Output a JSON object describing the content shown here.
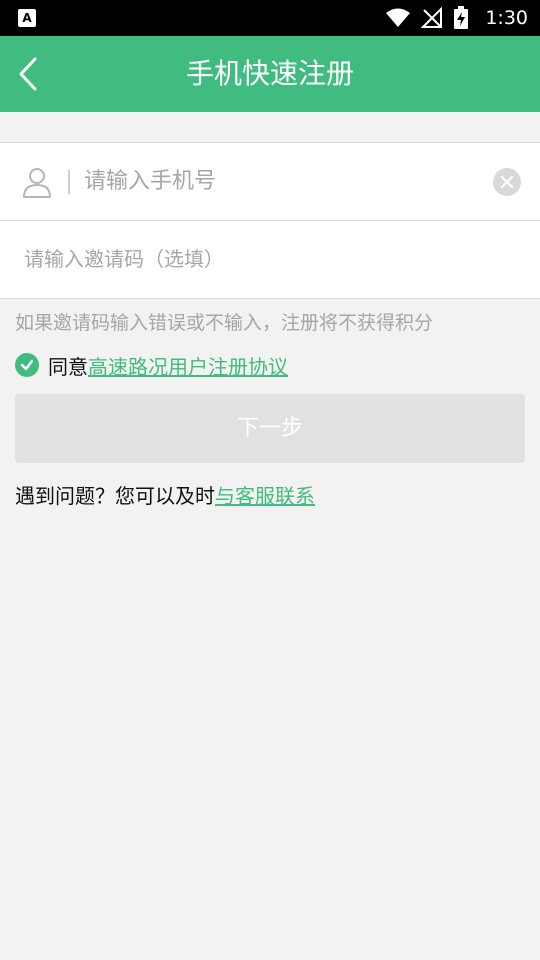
{
  "status_bar": {
    "left_icon": "A",
    "time": "1:30",
    "icons": [
      "wifi-icon",
      "no-signal-icon",
      "battery-charging-icon"
    ]
  },
  "header": {
    "title": "手机快速注册",
    "back_icon": "chevron-left-icon",
    "background_color": "#41bc80"
  },
  "form": {
    "phone": {
      "placeholder": "请输入手机号",
      "value": "",
      "icon": "user-icon",
      "clear_icon": "clear-icon"
    },
    "invite": {
      "placeholder": "请输入邀请码（选填）",
      "value": ""
    }
  },
  "hint": "如果邀请码输入错误或不输入，注册将不获得积分",
  "agreement": {
    "checked": true,
    "prefix": "同意",
    "link_text": "高速路况用户注册协议"
  },
  "next_button": {
    "label": "下一步"
  },
  "help": {
    "prefix": "遇到问题？您可以及时",
    "link_text": "与客服联系"
  },
  "colors": {
    "accent": "#41bc80",
    "background": "#f2f2f2",
    "disabled_button": "#e1e1e1"
  }
}
